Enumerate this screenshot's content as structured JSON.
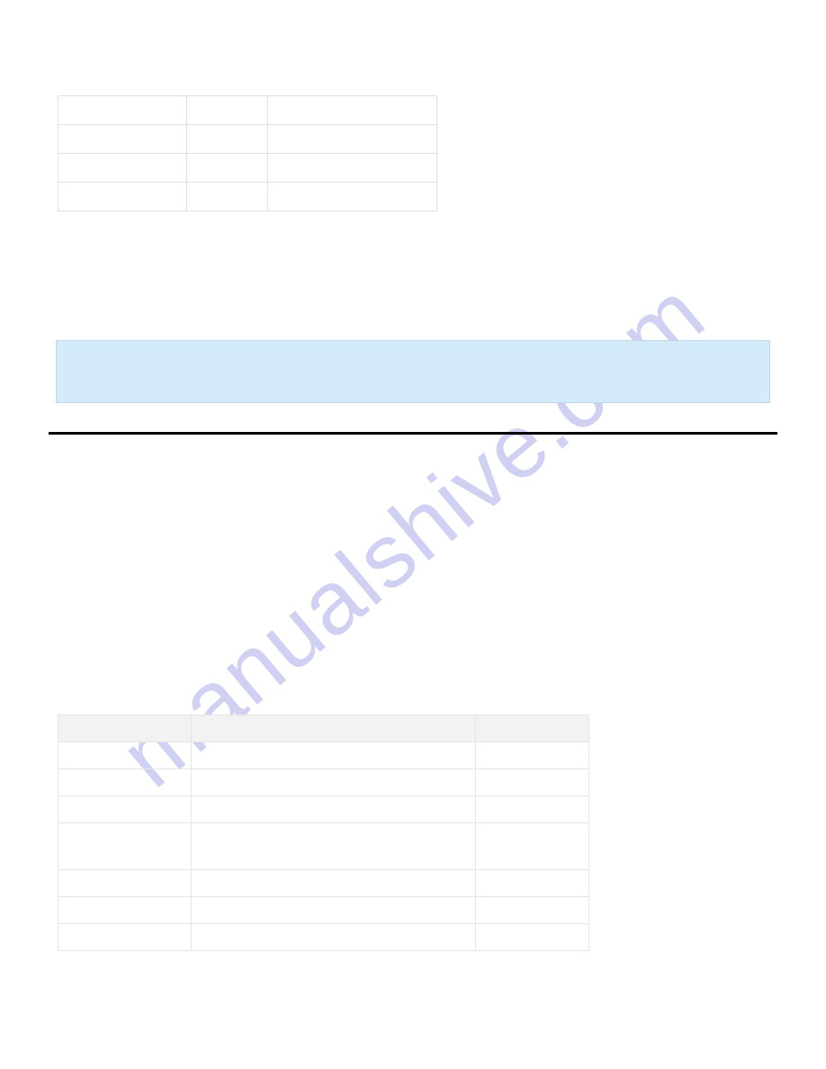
{
  "watermark": "manualshive.com",
  "top_table": {
    "rows": [
      {
        "c1": "",
        "c2": "",
        "c3": ""
      },
      {
        "c1": "",
        "c2": "",
        "c3": ""
      },
      {
        "c1": "",
        "c2": "",
        "c3": ""
      },
      {
        "c1": "",
        "c2": "",
        "c3": ""
      }
    ]
  },
  "blue_banner": {
    "text": ""
  },
  "bottom_table": {
    "header": {
      "b1": "",
      "b2": "",
      "b3": ""
    },
    "rows": [
      {
        "b1": "",
        "b2": "",
        "b3": "",
        "tall": false
      },
      {
        "b1": "",
        "b2": "",
        "b3": "",
        "tall": false
      },
      {
        "b1": "",
        "b2": "",
        "b3": "",
        "tall": false
      },
      {
        "b1": "",
        "b2": "",
        "b3": "",
        "tall": true
      },
      {
        "b1": "",
        "b2": "",
        "b3": "",
        "tall": false
      },
      {
        "b1": "",
        "b2": "",
        "b3": "",
        "tall": false
      },
      {
        "b1": "",
        "b2": "",
        "b3": "",
        "tall": false
      }
    ]
  }
}
